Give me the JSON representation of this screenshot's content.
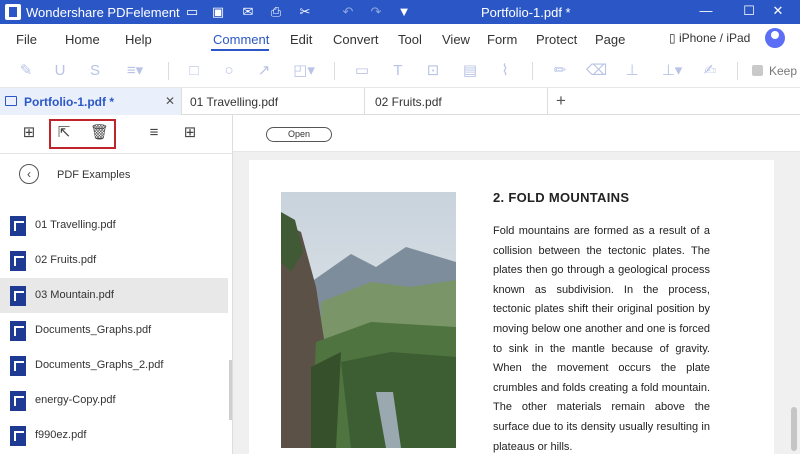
{
  "titlebar": {
    "app_name": "Wondershare PDFelement",
    "document_title": "Portfolio-1.pdf *",
    "minimize": "—",
    "maximize": "☐",
    "close": "✕"
  },
  "menu": {
    "items": [
      "File",
      "Home",
      "Help",
      "Comment",
      "Edit",
      "Convert",
      "Tool",
      "View",
      "Form",
      "Protect",
      "Page"
    ],
    "active": "Comment",
    "device_label": "iPhone / iPad"
  },
  "toolbar": {
    "keep_label": "Keep"
  },
  "tabs": [
    {
      "label": "Portfolio-1.pdf *",
      "close": "✕"
    },
    {
      "label": "01 Travelling.pdf"
    },
    {
      "label": "02 Fruits.pdf"
    }
  ],
  "new_tab": "+",
  "sidebar": {
    "folder_title": "PDF Examples",
    "files": [
      {
        "name": "01 Travelling.pdf"
      },
      {
        "name": "02 Fruits.pdf"
      },
      {
        "name": "03 Mountain.pdf"
      },
      {
        "name": "Documents_Graphs.pdf"
      },
      {
        "name": "Documents_Graphs_2.pdf"
      },
      {
        "name": "energy-Copy.pdf"
      },
      {
        "name": "f990ez.pdf"
      }
    ],
    "selected_index": 2
  },
  "document": {
    "open_button": "Open",
    "heading": "2. FOLD MOUNTAINS",
    "body": "Fold mountains are formed as a result of a collision between the tectonic plates. The plates then go through a geological process known as subdivision. In the process, tectonic plates shift their original position by moving below one another and one is forced to sink in the mantle because of gravity. When the movement occurs the plate crumbles and folds creating a fold mountain. The other materials remain above the surface due to its density usually resulting in plateaus or hills."
  },
  "colors": {
    "accent": "#2b57c6",
    "highlight": "#c0242a"
  }
}
